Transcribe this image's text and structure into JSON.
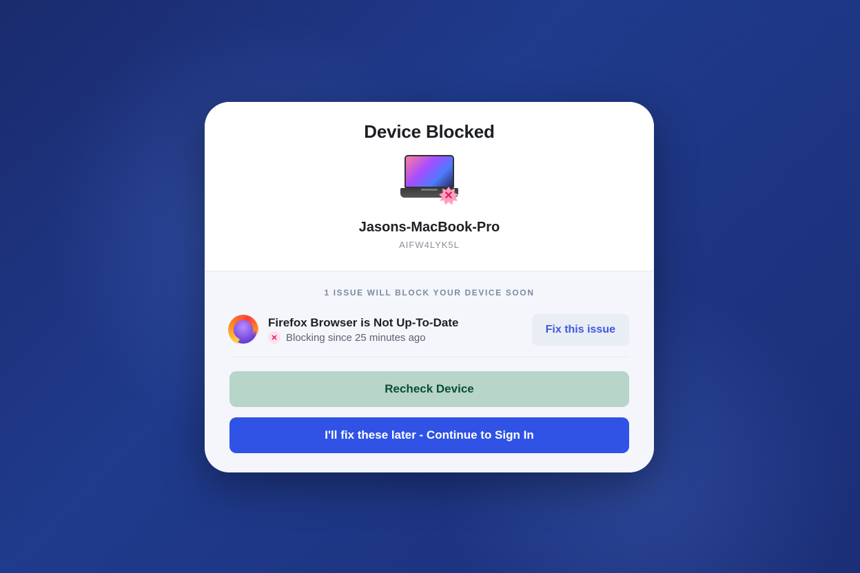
{
  "modal": {
    "title": "Device Blocked",
    "device_name": "Jasons-MacBook-Pro",
    "device_serial": "AIFW4LYK5L"
  },
  "issues": {
    "caption": "1 ISSUE WILL BLOCK YOUR DEVICE SOON",
    "items": [
      {
        "icon": "firefox-icon",
        "title": "Firefox Browser is Not Up-To-Date",
        "status_text": "Blocking since 25 minutes ago",
        "fix_label": "Fix this issue"
      }
    ]
  },
  "actions": {
    "recheck_label": "Recheck Device",
    "continue_label": "I'll fix these later - Continue to Sign In"
  }
}
